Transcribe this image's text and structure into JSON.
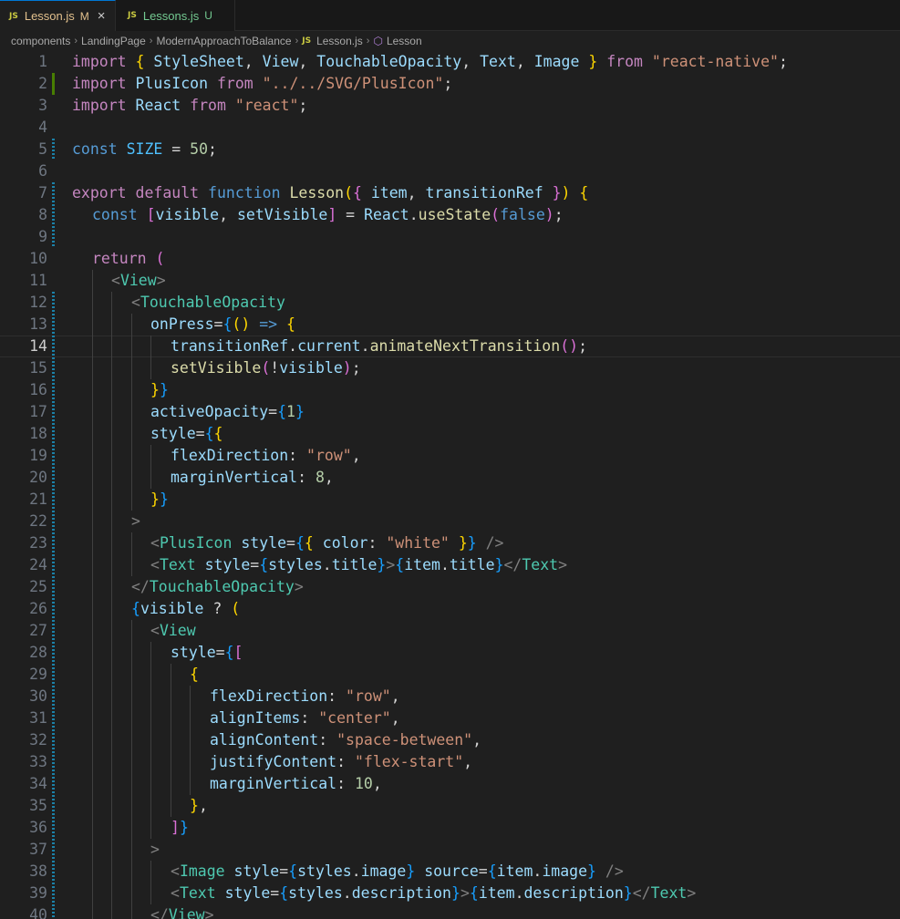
{
  "tabs": [
    {
      "icon": "JS",
      "label": "Lesson.js",
      "status": "M",
      "active": true,
      "closable": true
    },
    {
      "icon": "JS",
      "label": "Lessons.js",
      "status": "U",
      "active": false,
      "closable": false
    }
  ],
  "breadcrumb": {
    "folders": [
      "components",
      "LandingPage",
      "ModernApproachToBalance"
    ],
    "file_icon": "JS",
    "file": "Lesson.js",
    "symbol": "Lesson",
    "separator": "›"
  },
  "editor": {
    "current_line": 14,
    "lines": [
      {
        "n": "1",
        "indent": 0,
        "gutter": null,
        "tokens": [
          [
            "kw",
            "import"
          ],
          [
            "p",
            " "
          ],
          [
            "b1",
            "{"
          ],
          [
            "p",
            " "
          ],
          [
            "var",
            "StyleSheet"
          ],
          [
            "p",
            ", "
          ],
          [
            "var",
            "View"
          ],
          [
            "p",
            ", "
          ],
          [
            "var",
            "TouchableOpacity"
          ],
          [
            "p",
            ", "
          ],
          [
            "var",
            "Text"
          ],
          [
            "p",
            ", "
          ],
          [
            "var",
            "Image"
          ],
          [
            "p",
            " "
          ],
          [
            "b1",
            "}"
          ],
          [
            "p",
            " "
          ],
          [
            "kw",
            "from"
          ],
          [
            "p",
            " "
          ],
          [
            "str",
            "\"react-native\""
          ],
          [
            "p",
            ";"
          ]
        ]
      },
      {
        "n": "2",
        "indent": 0,
        "gutter": "added",
        "tokens": [
          [
            "kw",
            "import"
          ],
          [
            "p",
            " "
          ],
          [
            "var",
            "PlusIcon"
          ],
          [
            "p",
            " "
          ],
          [
            "kw",
            "from"
          ],
          [
            "p",
            " "
          ],
          [
            "str",
            "\"../../SVG/PlusIcon\""
          ],
          [
            "p",
            ";"
          ]
        ]
      },
      {
        "n": "3",
        "indent": 0,
        "gutter": null,
        "tokens": [
          [
            "kw",
            "import"
          ],
          [
            "p",
            " "
          ],
          [
            "var",
            "React"
          ],
          [
            "p",
            " "
          ],
          [
            "kw",
            "from"
          ],
          [
            "p",
            " "
          ],
          [
            "str",
            "\"react\""
          ],
          [
            "p",
            ";"
          ]
        ]
      },
      {
        "n": "4",
        "indent": 0,
        "gutter": null,
        "tokens": []
      },
      {
        "n": "5",
        "indent": 0,
        "gutter": "modified",
        "tokens": [
          [
            "st",
            "const"
          ],
          [
            "p",
            " "
          ],
          [
            "cst",
            "SIZE"
          ],
          [
            "p",
            " = "
          ],
          [
            "num",
            "50"
          ],
          [
            "p",
            ";"
          ]
        ]
      },
      {
        "n": "6",
        "indent": 0,
        "gutter": null,
        "tokens": []
      },
      {
        "n": "7",
        "indent": 0,
        "gutter": "modified",
        "tokens": [
          [
            "kw",
            "export"
          ],
          [
            "p",
            " "
          ],
          [
            "kw",
            "default"
          ],
          [
            "p",
            " "
          ],
          [
            "st",
            "function"
          ],
          [
            "p",
            " "
          ],
          [
            "fn",
            "Lesson"
          ],
          [
            "b1",
            "("
          ],
          [
            "b2",
            "{"
          ],
          [
            "p",
            " "
          ],
          [
            "var",
            "item"
          ],
          [
            "p",
            ", "
          ],
          [
            "var",
            "transitionRef"
          ],
          [
            "p",
            " "
          ],
          [
            "b2",
            "}"
          ],
          [
            "b1",
            ")"
          ],
          [
            "p",
            " "
          ],
          [
            "b1",
            "{"
          ]
        ]
      },
      {
        "n": "8",
        "indent": 1,
        "gutter": "modified",
        "tokens": [
          [
            "st",
            "const"
          ],
          [
            "p",
            " "
          ],
          [
            "b2",
            "["
          ],
          [
            "var",
            "visible"
          ],
          [
            "p",
            ", "
          ],
          [
            "var",
            "setVisible"
          ],
          [
            "b2",
            "]"
          ],
          [
            "p",
            " = "
          ],
          [
            "var",
            "React"
          ],
          [
            "p",
            "."
          ],
          [
            "fn",
            "useState"
          ],
          [
            "b2",
            "("
          ],
          [
            "st",
            "false"
          ],
          [
            "b2",
            ")"
          ],
          [
            "p",
            ";"
          ]
        ]
      },
      {
        "n": "9",
        "indent": 1,
        "gutter": "modified",
        "tokens": []
      },
      {
        "n": "10",
        "indent": 1,
        "gutter": null,
        "tokens": [
          [
            "kw",
            "return"
          ],
          [
            "p",
            " "
          ],
          [
            "b2",
            "("
          ]
        ]
      },
      {
        "n": "11",
        "indent": 2,
        "gutter": null,
        "tokens": [
          [
            "tp",
            "<"
          ],
          [
            "tag",
            "View"
          ],
          [
            "tp",
            ">"
          ]
        ]
      },
      {
        "n": "12",
        "indent": 3,
        "gutter": "modified",
        "tokens": [
          [
            "tp",
            "<"
          ],
          [
            "tag",
            "TouchableOpacity"
          ]
        ]
      },
      {
        "n": "13",
        "indent": 4,
        "gutter": "modified",
        "tokens": [
          [
            "var",
            "onPress"
          ],
          [
            "p",
            "="
          ],
          [
            "b3",
            "{"
          ],
          [
            "b1",
            "()"
          ],
          [
            "p",
            " "
          ],
          [
            "st",
            "=>"
          ],
          [
            "p",
            " "
          ],
          [
            "b1",
            "{"
          ]
        ]
      },
      {
        "n": "14",
        "indent": 5,
        "gutter": "modified",
        "tokens": [
          [
            "var",
            "transitionRef"
          ],
          [
            "p",
            "."
          ],
          [
            "var",
            "current"
          ],
          [
            "p",
            "."
          ],
          [
            "fn",
            "animateNextTransition"
          ],
          [
            "b2",
            "()"
          ],
          [
            "p",
            ";"
          ]
        ]
      },
      {
        "n": "15",
        "indent": 5,
        "gutter": "modified",
        "tokens": [
          [
            "fn",
            "setVisible"
          ],
          [
            "b2",
            "("
          ],
          [
            "p",
            "!"
          ],
          [
            "var",
            "visible"
          ],
          [
            "b2",
            ")"
          ],
          [
            "p",
            ";"
          ]
        ]
      },
      {
        "n": "16",
        "indent": 4,
        "gutter": "modified",
        "tokens": [
          [
            "b1",
            "}"
          ],
          [
            "b3",
            "}"
          ]
        ]
      },
      {
        "n": "17",
        "indent": 4,
        "gutter": "modified",
        "tokens": [
          [
            "var",
            "activeOpacity"
          ],
          [
            "p",
            "="
          ],
          [
            "b3",
            "{"
          ],
          [
            "num",
            "1"
          ],
          [
            "b3",
            "}"
          ]
        ]
      },
      {
        "n": "18",
        "indent": 4,
        "gutter": "modified",
        "tokens": [
          [
            "var",
            "style"
          ],
          [
            "p",
            "="
          ],
          [
            "b3",
            "{"
          ],
          [
            "b1",
            "{"
          ]
        ]
      },
      {
        "n": "19",
        "indent": 5,
        "gutter": "modified",
        "tokens": [
          [
            "var",
            "flexDirection"
          ],
          [
            "p",
            ": "
          ],
          [
            "str",
            "\"row\""
          ],
          [
            "p",
            ","
          ]
        ]
      },
      {
        "n": "20",
        "indent": 5,
        "gutter": "modified",
        "tokens": [
          [
            "var",
            "marginVertical"
          ],
          [
            "p",
            ": "
          ],
          [
            "num",
            "8"
          ],
          [
            "p",
            ","
          ]
        ]
      },
      {
        "n": "21",
        "indent": 4,
        "gutter": "modified",
        "tokens": [
          [
            "b1",
            "}"
          ],
          [
            "b3",
            "}"
          ]
        ]
      },
      {
        "n": "22",
        "indent": 3,
        "gutter": "modified",
        "tokens": [
          [
            "tp",
            ">"
          ]
        ]
      },
      {
        "n": "23",
        "indent": 4,
        "gutter": "modified",
        "tokens": [
          [
            "tp",
            "<"
          ],
          [
            "tag",
            "PlusIcon"
          ],
          [
            "p",
            " "
          ],
          [
            "var",
            "style"
          ],
          [
            "p",
            "="
          ],
          [
            "b3",
            "{"
          ],
          [
            "b1",
            "{"
          ],
          [
            "p",
            " "
          ],
          [
            "var",
            "color"
          ],
          [
            "p",
            ": "
          ],
          [
            "str",
            "\"white\""
          ],
          [
            "p",
            " "
          ],
          [
            "b1",
            "}"
          ],
          [
            "b3",
            "}"
          ],
          [
            "p",
            " "
          ],
          [
            "tp",
            "/>"
          ]
        ]
      },
      {
        "n": "24",
        "indent": 4,
        "gutter": "modified",
        "tokens": [
          [
            "tp",
            "<"
          ],
          [
            "tag",
            "Text"
          ],
          [
            "p",
            " "
          ],
          [
            "var",
            "style"
          ],
          [
            "p",
            "="
          ],
          [
            "b3",
            "{"
          ],
          [
            "var",
            "styles"
          ],
          [
            "p",
            "."
          ],
          [
            "var",
            "title"
          ],
          [
            "b3",
            "}"
          ],
          [
            "tp",
            ">"
          ],
          [
            "b3",
            "{"
          ],
          [
            "var",
            "item"
          ],
          [
            "p",
            "."
          ],
          [
            "var",
            "title"
          ],
          [
            "b3",
            "}"
          ],
          [
            "tp",
            "</"
          ],
          [
            "tag",
            "Text"
          ],
          [
            "tp",
            ">"
          ]
        ]
      },
      {
        "n": "25",
        "indent": 3,
        "gutter": "modified",
        "tokens": [
          [
            "tp",
            "</"
          ],
          [
            "tag",
            "TouchableOpacity"
          ],
          [
            "tp",
            ">"
          ]
        ]
      },
      {
        "n": "26",
        "indent": 3,
        "gutter": "modified",
        "tokens": [
          [
            "b3",
            "{"
          ],
          [
            "var",
            "visible"
          ],
          [
            "p",
            " ? "
          ],
          [
            "b1",
            "("
          ]
        ]
      },
      {
        "n": "27",
        "indent": 4,
        "gutter": "modified",
        "tokens": [
          [
            "tp",
            "<"
          ],
          [
            "tag",
            "View"
          ]
        ]
      },
      {
        "n": "28",
        "indent": 5,
        "gutter": "modified",
        "tokens": [
          [
            "var",
            "style"
          ],
          [
            "p",
            "="
          ],
          [
            "b3",
            "{"
          ],
          [
            "b2",
            "["
          ]
        ]
      },
      {
        "n": "29",
        "indent": 6,
        "gutter": "modified",
        "tokens": [
          [
            "b1",
            "{"
          ]
        ]
      },
      {
        "n": "30",
        "indent": 7,
        "gutter": "modified",
        "tokens": [
          [
            "var",
            "flexDirection"
          ],
          [
            "p",
            ": "
          ],
          [
            "str",
            "\"row\""
          ],
          [
            "p",
            ","
          ]
        ]
      },
      {
        "n": "31",
        "indent": 7,
        "gutter": "modified",
        "tokens": [
          [
            "var",
            "alignItems"
          ],
          [
            "p",
            ": "
          ],
          [
            "str",
            "\"center\""
          ],
          [
            "p",
            ","
          ]
        ]
      },
      {
        "n": "32",
        "indent": 7,
        "gutter": "modified",
        "tokens": [
          [
            "var",
            "alignContent"
          ],
          [
            "p",
            ": "
          ],
          [
            "str",
            "\"space-between\""
          ],
          [
            "p",
            ","
          ]
        ]
      },
      {
        "n": "33",
        "indent": 7,
        "gutter": "modified",
        "tokens": [
          [
            "var",
            "justifyContent"
          ],
          [
            "p",
            ": "
          ],
          [
            "str",
            "\"flex-start\""
          ],
          [
            "p",
            ","
          ]
        ]
      },
      {
        "n": "34",
        "indent": 7,
        "gutter": "modified",
        "tokens": [
          [
            "var",
            "marginVertical"
          ],
          [
            "p",
            ": "
          ],
          [
            "num",
            "10"
          ],
          [
            "p",
            ","
          ]
        ]
      },
      {
        "n": "35",
        "indent": 6,
        "gutter": "modified",
        "tokens": [
          [
            "b1",
            "}"
          ],
          [
            "p",
            ","
          ]
        ]
      },
      {
        "n": "36",
        "indent": 5,
        "gutter": "modified",
        "tokens": [
          [
            "b2",
            "]"
          ],
          [
            "b3",
            "}"
          ]
        ]
      },
      {
        "n": "37",
        "indent": 4,
        "gutter": "modified",
        "tokens": [
          [
            "tp",
            ">"
          ]
        ]
      },
      {
        "n": "38",
        "indent": 5,
        "gutter": "modified",
        "tokens": [
          [
            "tp",
            "<"
          ],
          [
            "tag",
            "Image"
          ],
          [
            "p",
            " "
          ],
          [
            "var",
            "style"
          ],
          [
            "p",
            "="
          ],
          [
            "b3",
            "{"
          ],
          [
            "var",
            "styles"
          ],
          [
            "p",
            "."
          ],
          [
            "var",
            "image"
          ],
          [
            "b3",
            "}"
          ],
          [
            "p",
            " "
          ],
          [
            "var",
            "source"
          ],
          [
            "p",
            "="
          ],
          [
            "b3",
            "{"
          ],
          [
            "var",
            "item"
          ],
          [
            "p",
            "."
          ],
          [
            "var",
            "image"
          ],
          [
            "b3",
            "}"
          ],
          [
            "p",
            " "
          ],
          [
            "tp",
            "/>"
          ]
        ]
      },
      {
        "n": "39",
        "indent": 5,
        "gutter": "modified",
        "tokens": [
          [
            "tp",
            "<"
          ],
          [
            "tag",
            "Text"
          ],
          [
            "p",
            " "
          ],
          [
            "var",
            "style"
          ],
          [
            "p",
            "="
          ],
          [
            "b3",
            "{"
          ],
          [
            "var",
            "styles"
          ],
          [
            "p",
            "."
          ],
          [
            "var",
            "description"
          ],
          [
            "b3",
            "}"
          ],
          [
            "tp",
            ">"
          ],
          [
            "b3",
            "{"
          ],
          [
            "var",
            "item"
          ],
          [
            "p",
            "."
          ],
          [
            "var",
            "description"
          ],
          [
            "b3",
            "}"
          ],
          [
            "tp",
            "</"
          ],
          [
            "tag",
            "Text"
          ],
          [
            "tp",
            ">"
          ]
        ]
      },
      {
        "n": "40",
        "indent": 4,
        "gutter": "modified",
        "tokens": [
          [
            "tp",
            "</"
          ],
          [
            "tag",
            "View"
          ],
          [
            "tp",
            ">"
          ]
        ]
      }
    ]
  }
}
